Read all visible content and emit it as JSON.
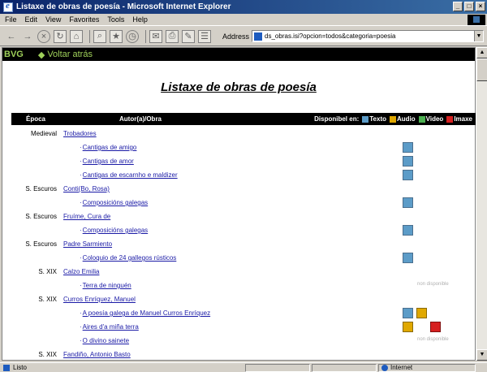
{
  "window": {
    "title": "Listaxe de obras de poesía - Microsoft Internet Explorer",
    "minimize": "_",
    "maximize": "□",
    "close": "×"
  },
  "menu": [
    "Edit",
    "Edit",
    "View",
    "Favorites",
    "Tools",
    "Help"
  ],
  "menu_labels": [
    "File",
    "Edit",
    "View",
    "Favorites",
    "Tools",
    "Help"
  ],
  "toolbar": {
    "address_label": "Address",
    "address_value": "ds_obras.isi?opcion=todos&categoria=poesia",
    "dropdown_icon": "▼"
  },
  "nav": {
    "bvg_label": "BVG",
    "back_label": "Voltar atrás",
    "back_arrow": "◆"
  },
  "page": {
    "title": "Listaxe de obras de poesía"
  },
  "table": {
    "header_epoca": "Época",
    "header_autor": "Autor(a)/Obra",
    "header_disponibel": "Disponibel en:",
    "legend": [
      {
        "label": "Texto",
        "color": "#5c9cc8"
      },
      {
        "label": "Audio",
        "color": "#e0a800"
      },
      {
        "label": "Video",
        "color": "#4caf50"
      },
      {
        "label": "Imaxe",
        "color": "#d62020"
      }
    ],
    "rows": [
      {
        "epoca": "Medieval",
        "author": "Trobadores",
        "level": "author",
        "media": []
      },
      {
        "epoca": "",
        "work": "Cantigas de amigo",
        "level": "work",
        "media": [
          "texto"
        ]
      },
      {
        "epoca": "",
        "work": "Cantigas de amor",
        "level": "work",
        "media": [
          "texto"
        ]
      },
      {
        "epoca": "",
        "work": "Cantigas de escarnho e maldizer",
        "level": "work",
        "media": [
          "texto"
        ]
      },
      {
        "epoca": "S. Escuros",
        "author": "Conti(Bo, Rosa)",
        "level": "author",
        "media": []
      },
      {
        "epoca": "",
        "work": "Composicións galegas",
        "level": "work",
        "media": [
          "texto"
        ]
      },
      {
        "epoca": "S. Escuros",
        "author": "Fruíme, Cura de",
        "level": "author",
        "media": []
      },
      {
        "epoca": "",
        "work": "Composicións galegas",
        "level": "work",
        "media": [
          "texto"
        ]
      },
      {
        "epoca": "S. Escuros",
        "author": "Padre Sarmiento",
        "level": "author",
        "media": []
      },
      {
        "epoca": "",
        "work": "Coloquio de 24 gallegos rústicos",
        "level": "work",
        "media": [
          "texto"
        ]
      },
      {
        "epoca": "S. XIX",
        "author": "Calzo Emilia",
        "level": "author",
        "media": []
      },
      {
        "epoca": "",
        "work": "Terra de ninguén",
        "level": "work",
        "media": [],
        "no_disp": "non disponible"
      },
      {
        "epoca": "S. XIX",
        "author": "Curros Enríquez, Manuel",
        "level": "author",
        "media": []
      },
      {
        "epoca": "",
        "work": "A poesía galega de Manuel Curros Enríquez",
        "level": "work",
        "media": [
          "texto",
          "audio"
        ]
      },
      {
        "epoca": "",
        "work": "Aires d'a miña terra",
        "level": "work",
        "media": [
          "audio",
          "",
          "imaxe"
        ]
      },
      {
        "epoca": "",
        "work": "O divino sainete",
        "level": "work",
        "media": [],
        "no_disp": "non disponible"
      },
      {
        "epoca": "S. XIX",
        "author": "Fandiño, Antonio Basto",
        "level": "author",
        "media": []
      }
    ]
  },
  "status": {
    "left": "Listo",
    "zone": "Internet"
  }
}
